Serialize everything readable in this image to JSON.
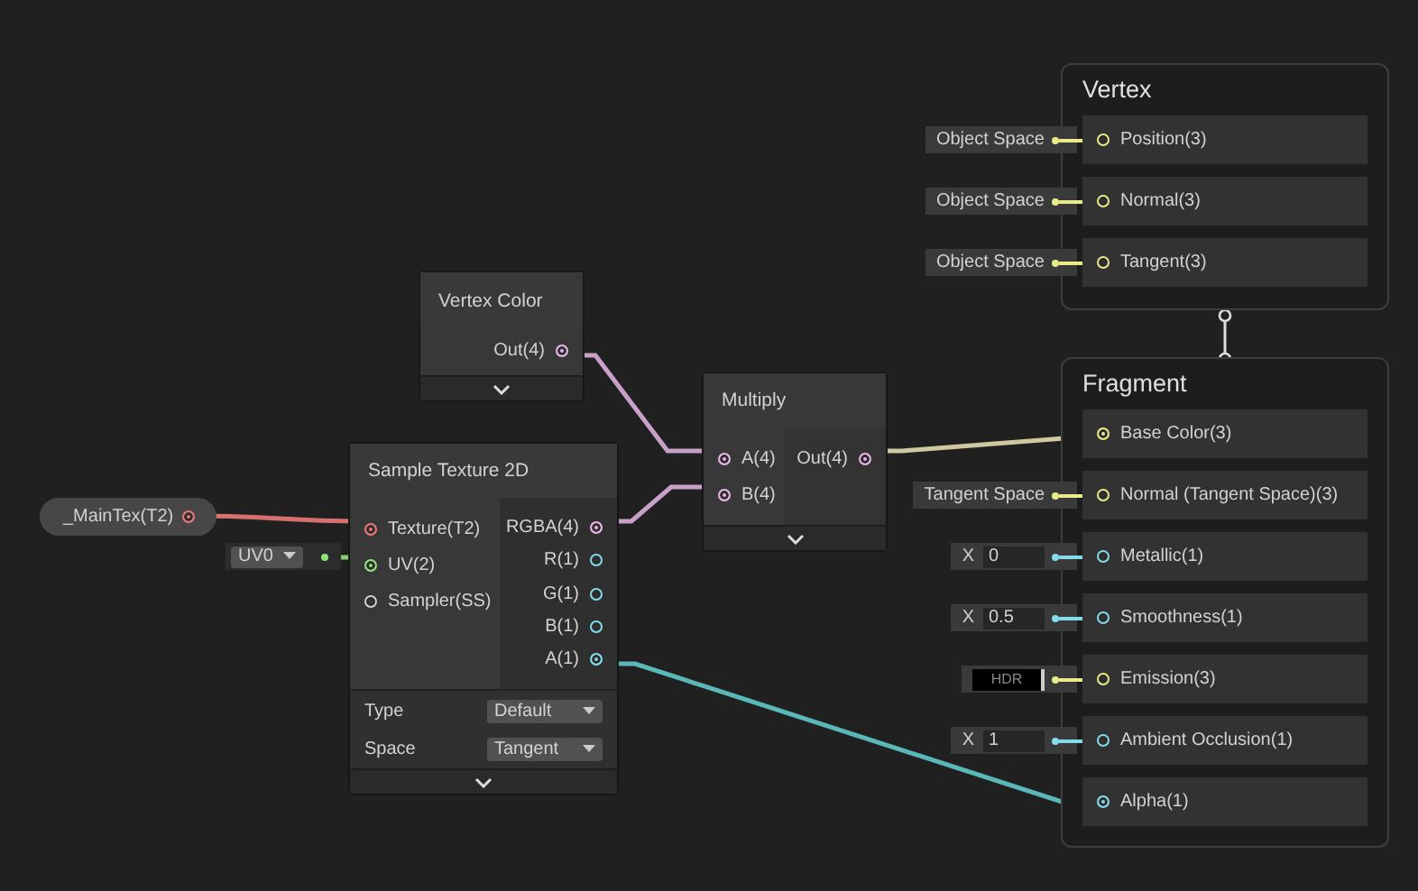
{
  "property_node": {
    "label": "_MainTex(T2)",
    "color": "#e87878"
  },
  "uv_input": {
    "value": "UV0",
    "color": "#90e07c"
  },
  "vertex_color_node": {
    "title": "Vertex Color",
    "outputs": [
      {
        "label": "Out(4)",
        "connected": true,
        "color": "#e8b4e8"
      }
    ]
  },
  "sample_texture_node": {
    "title": "Sample Texture 2D",
    "inputs": [
      {
        "label": "Texture(T2)",
        "connected": true,
        "color": "#e87878"
      },
      {
        "label": "UV(2)",
        "connected": true,
        "color": "#90e07c"
      },
      {
        "label": "Sampler(SS)",
        "connected": false,
        "color": "#d0d0d0"
      }
    ],
    "outputs": [
      {
        "label": "RGBA(4)",
        "connected": true,
        "color": "#e8b4e8"
      },
      {
        "label": "R(1)",
        "connected": false,
        "color": "#84dceb"
      },
      {
        "label": "G(1)",
        "connected": false,
        "color": "#84dceb"
      },
      {
        "label": "B(1)",
        "connected": false,
        "color": "#84dceb"
      },
      {
        "label": "A(1)",
        "connected": true,
        "color": "#84dceb"
      }
    ],
    "settings": [
      {
        "label": "Type",
        "value": "Default"
      },
      {
        "label": "Space",
        "value": "Tangent"
      }
    ]
  },
  "multiply_node": {
    "title": "Multiply",
    "inputs": [
      {
        "label": "A(4)",
        "connected": true,
        "color": "#e8b4e8"
      },
      {
        "label": "B(4)",
        "connected": true,
        "color": "#e8b4e8"
      }
    ],
    "outputs": [
      {
        "label": "Out(4)",
        "connected": true,
        "color": "#e8b4e8"
      }
    ]
  },
  "vertex_block": {
    "title": "Vertex",
    "slots": [
      {
        "label": "Position(3)",
        "connected": false,
        "color": "#eaea8a",
        "input": {
          "kind": "space",
          "text": "Object Space"
        }
      },
      {
        "label": "Normal(3)",
        "connected": false,
        "color": "#eaea8a",
        "input": {
          "kind": "space",
          "text": "Object Space"
        }
      },
      {
        "label": "Tangent(3)",
        "connected": false,
        "color": "#eaea8a",
        "input": {
          "kind": "space",
          "text": "Object Space"
        }
      }
    ]
  },
  "fragment_block": {
    "title": "Fragment",
    "slots": [
      {
        "label": "Base Color(3)",
        "connected": true,
        "color": "#eaea8a",
        "input": {
          "kind": "none"
        }
      },
      {
        "label": "Normal (Tangent Space)(3)",
        "connected": false,
        "color": "#eaea8a",
        "input": {
          "kind": "space",
          "text": "Tangent Space"
        }
      },
      {
        "label": "Metallic(1)",
        "connected": false,
        "color": "#84dceb",
        "input": {
          "kind": "float",
          "axis": "X",
          "value": "0"
        }
      },
      {
        "label": "Smoothness(1)",
        "connected": false,
        "color": "#84dceb",
        "input": {
          "kind": "float",
          "axis": "X",
          "value": "0.5"
        }
      },
      {
        "label": "Emission(3)",
        "connected": false,
        "color": "#eaea8a",
        "input": {
          "kind": "hdr",
          "text": "HDR"
        }
      },
      {
        "label": "Ambient Occlusion(1)",
        "connected": false,
        "color": "#84dceb",
        "input": {
          "kind": "float",
          "axis": "X",
          "value": "1"
        }
      },
      {
        "label": "Alpha(1)",
        "connected": true,
        "color": "#84dceb",
        "input": {
          "kind": "none"
        }
      }
    ]
  }
}
